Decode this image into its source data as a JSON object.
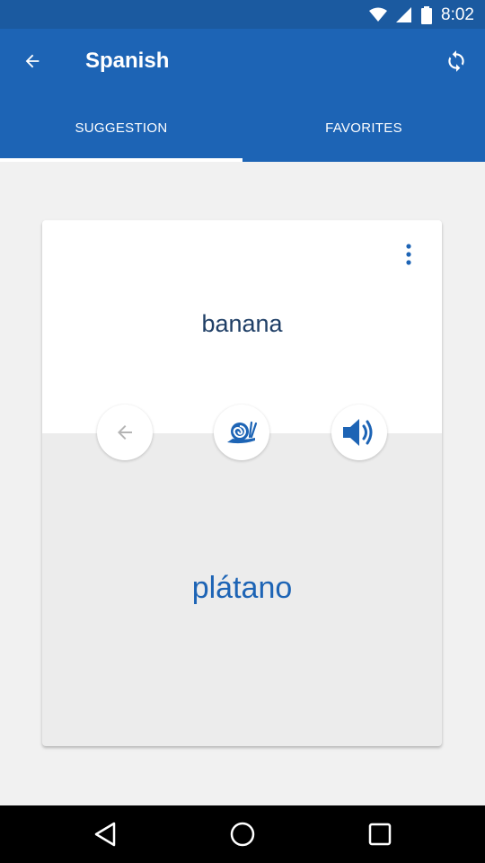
{
  "status_bar": {
    "time": "8:02"
  },
  "app_bar": {
    "title": "Spanish"
  },
  "tabs": [
    {
      "label": "SUGGESTION",
      "selected": true
    },
    {
      "label": "FAVORITES",
      "selected": false
    }
  ],
  "card": {
    "english_word": "banana",
    "spanish_word": "plátano"
  },
  "colors": {
    "primary": "#1d64b5",
    "status_bar": "#1b5aa0",
    "card_text": "#1f3f66"
  },
  "icons": {
    "back": "arrow-left-icon",
    "refresh": "refresh-icon",
    "more": "more-vertical-icon",
    "previous": "arrow-left-icon",
    "slow": "snail-icon",
    "audio": "speaker-icon"
  }
}
